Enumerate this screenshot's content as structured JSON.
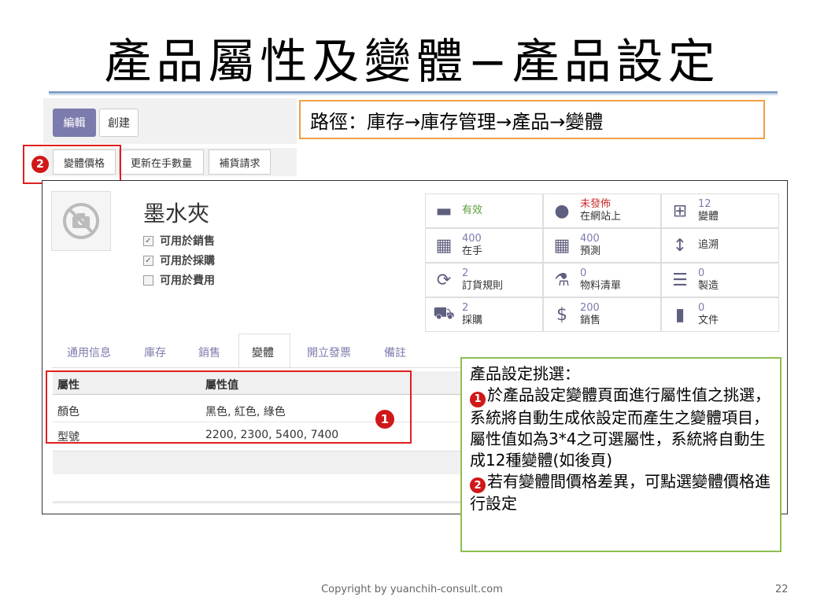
{
  "slide": {
    "title": "產品屬性及變體−產品設定",
    "footer": "Copyright  by yuanchih-consult.com",
    "page_number": "22"
  },
  "toolbar": {
    "edit_label": "編輯",
    "create_label": "創建"
  },
  "path_text": "路徑：庫存→庫存管理→產品→變體",
  "action_buttons": [
    "變體價格",
    "更新在手數量",
    "補貨請求"
  ],
  "badges": {
    "one": "1",
    "two": "2"
  },
  "product": {
    "name": "墨水夾",
    "checks": [
      {
        "label": "可用於銷售",
        "checked": true
      },
      {
        "label": "可用於採購",
        "checked": true
      },
      {
        "label": "可用於費用",
        "checked": false
      }
    ]
  },
  "smart_buttons": [
    {
      "icon": "archive-icon",
      "value": "",
      "label": "有效",
      "accent": "#5a9e3c"
    },
    {
      "icon": "globe-icon",
      "value": "未發佈",
      "label": "在網站上",
      "accent": "#d03030"
    },
    {
      "icon": "sitemap-icon",
      "value": "12",
      "label": "變體"
    },
    {
      "icon": "building-icon",
      "value": "400",
      "label": "在手"
    },
    {
      "icon": "building-icon",
      "value": "400",
      "label": "預測"
    },
    {
      "icon": "arrows-v-icon",
      "value": "",
      "label": "追溯"
    },
    {
      "icon": "refresh-icon",
      "value": "2",
      "label": "訂貨規則"
    },
    {
      "icon": "flask-icon",
      "value": "0",
      "label": "物料清單"
    },
    {
      "icon": "list-icon",
      "value": "0",
      "label": "製造"
    },
    {
      "icon": "cart-icon",
      "value": "2",
      "label": "採購"
    },
    {
      "icon": "dollar-icon",
      "value": "200",
      "label": "銷售"
    },
    {
      "icon": "file-icon",
      "value": "0",
      "label": "文件"
    }
  ],
  "notebook_tabs": [
    "通用信息",
    "庫存",
    "銷售",
    "變體",
    "開立發票",
    "備註"
  ],
  "attributes_table": {
    "headers": [
      "屬性",
      "屬性值"
    ],
    "rows": [
      {
        "attribute": "顏色",
        "values": "黑色, 紅色, 綠色"
      },
      {
        "attribute": "型號",
        "values": "2200, 2300, 5400, 7400"
      }
    ]
  },
  "note": {
    "heading": "產品設定挑選：",
    "point1": "於產品設定變體頁面進行屬性值之挑選，系統將自動生成依設定而產生之變體項目，屬性值如為3*4之可選屬性，系統將自動生成12種變體(如後頁)",
    "point2": "若有變體間價格差異，可點選變體價格進行設定"
  }
}
